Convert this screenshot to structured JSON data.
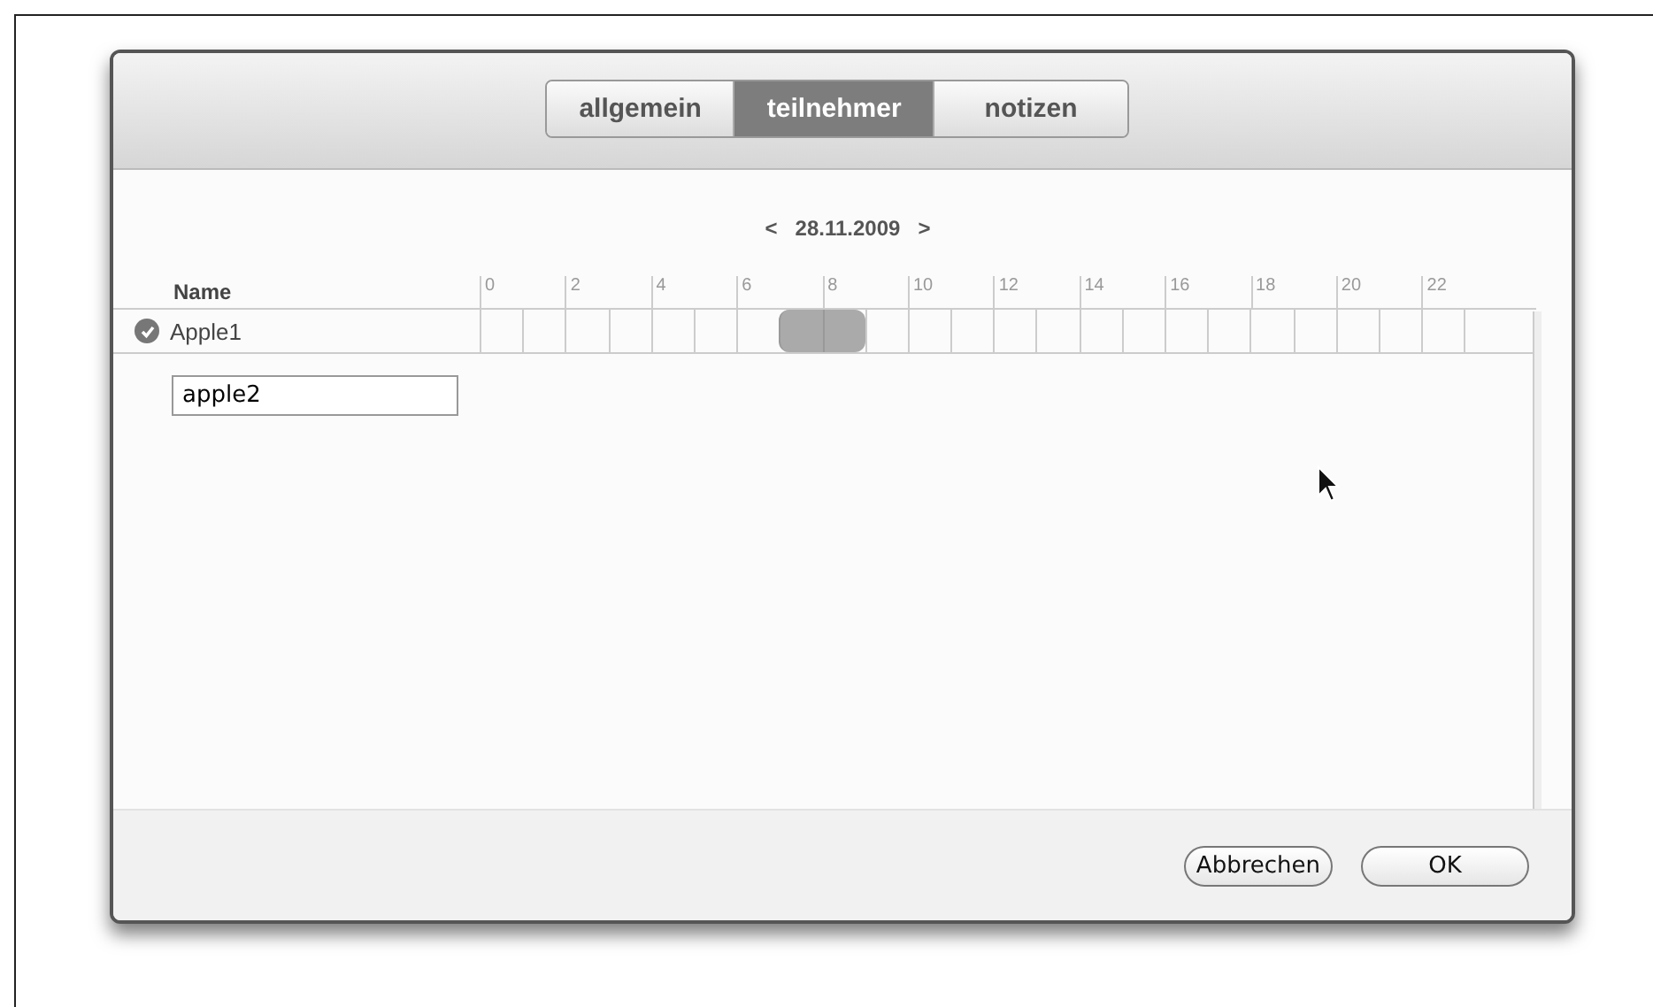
{
  "tabs": [
    {
      "label": "allgemein",
      "selected": false
    },
    {
      "label": "teilnehmer",
      "selected": true
    },
    {
      "label": "notizen",
      "selected": false
    }
  ],
  "date_nav": {
    "prev": "<",
    "date": "28.11.2009",
    "next": ">"
  },
  "name_column": "Name",
  "hour_ticks": [
    "0",
    "2",
    "4",
    "6",
    "8",
    "10",
    "12",
    "14",
    "16",
    "18",
    "20",
    "22"
  ],
  "participants": [
    {
      "name": "Apple1",
      "checked": true,
      "slots": [
        {
          "busy": false
        },
        {
          "busy": false
        },
        {
          "busy": false
        },
        {
          "busy": false
        },
        {
          "busy": false
        },
        {
          "busy": false
        },
        {
          "busy": false
        },
        {
          "busy": true
        },
        {
          "busy": true
        },
        {
          "busy": false
        },
        {
          "busy": false
        },
        {
          "busy": false
        },
        {
          "busy": false
        },
        {
          "busy": false
        },
        {
          "busy": false
        },
        {
          "busy": false
        },
        {
          "busy": false
        },
        {
          "busy": false
        },
        {
          "busy": false
        },
        {
          "busy": false
        },
        {
          "busy": false
        },
        {
          "busy": false
        },
        {
          "busy": false
        },
        {
          "busy": false
        }
      ]
    }
  ],
  "new_participant": {
    "value": "apple2"
  },
  "buttons": [
    {
      "label": "Abbrechen",
      "kind": "cancel"
    },
    {
      "label": "OK",
      "kind": "default"
    }
  ]
}
